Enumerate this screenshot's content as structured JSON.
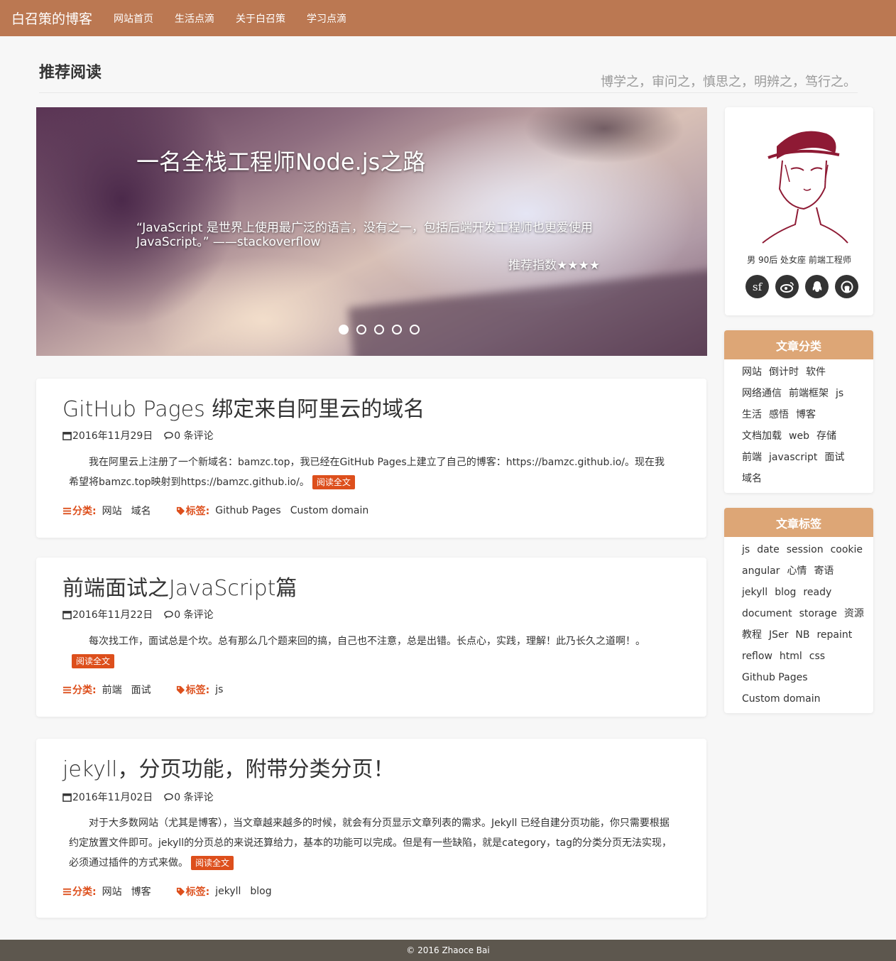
{
  "nav": {
    "brand": "白召策的博客",
    "items": [
      "网站首页",
      "生活点滴",
      "关于白召策",
      "学习点滴"
    ]
  },
  "header": {
    "title": "推荐阅读",
    "motto": "博学之，审问之，慎思之，明辨之，笃行之。"
  },
  "carousel": {
    "heading": "一名全栈工程师Node.js之路",
    "quote": "“JavaScript 是世界上使用最广泛的语言，没有之一，包括后端开发工程师也更爱使用 JavaScript。” ——stackoverflow",
    "rating": "推荐指数★★★★",
    "slide_count": 5,
    "active_index": 0
  },
  "posts": [
    {
      "title": "GitHub Pages 绑定来自阿里云的域名",
      "date": "2016年11月29日",
      "comments": "0 条评论",
      "excerpt": "我在阿里云上注册了一个新域名：bamzc.top，我已经在GitHub Pages上建立了自己的博客：https://bamzc.github.io/。现在我希望将bamzc.top映射到https://bamzc.github.io/。",
      "read_more": "阅读全文",
      "category_label": "分类:",
      "categories": [
        "网站",
        "域名"
      ],
      "tag_label": "标签:",
      "tags": [
        "Github Pages",
        "Custom domain"
      ]
    },
    {
      "title": "前端面试之JavaScript篇",
      "date": "2016年11月22日",
      "comments": "0 条评论",
      "excerpt": "每次找工作，面试总是个坎。总有那么几个题来回的搞，自己也不注意，总是出错。长点心，实践，理解！此乃长久之道啊！。",
      "read_more": "阅读全文",
      "category_label": "分类:",
      "categories": [
        "前端",
        "面试"
      ],
      "tag_label": "标签:",
      "tags": [
        "js"
      ]
    },
    {
      "title": "jekyll，分页功能，附带分类分页！",
      "date": "2016年11月02日",
      "comments": "0 条评论",
      "excerpt": "对于大多数网站（尤其是博客），当文章越来越多的时候，就会有分页显示文章列表的需求。Jekyll 已经自建分页功能，你只需要根据约定放置文件即可。jekyll的分页总的来说还算给力，基本的功能可以完成。但是有一些缺陷，就是category，tag的分类分页无法实现，必须通过插件的方式来做。",
      "read_more": "阅读全文",
      "category_label": "分类:",
      "categories": [
        "网站",
        "博客"
      ],
      "tag_label": "标签:",
      "tags": [
        "jekyll",
        "blog"
      ]
    }
  ],
  "profile": {
    "bio": "男 90后 处女座 前端工程师",
    "socials": [
      {
        "name": "segmentfault-icon",
        "glyph": "sf"
      },
      {
        "name": "weibo-icon",
        "glyph": ""
      },
      {
        "name": "qq-icon",
        "glyph": ""
      },
      {
        "name": "github-icon",
        "glyph": ""
      }
    ]
  },
  "categories_panel": {
    "title": "文章分类",
    "rows": [
      [
        "网站",
        "倒计时",
        "软件"
      ],
      [
        "网络通信",
        "前端框架",
        "js"
      ],
      [
        "生活",
        "感悟",
        "博客"
      ],
      [
        "文档加载",
        "web",
        "存储"
      ],
      [
        "前端",
        "javascript",
        "面试"
      ],
      [
        "域名"
      ]
    ]
  },
  "tags_panel": {
    "title": "文章标签",
    "rows": [
      [
        "js",
        "date",
        "session",
        "cookie"
      ],
      [
        "angular",
        "心情",
        "寄语"
      ],
      [
        "jekyll",
        "blog",
        "ready"
      ],
      [
        "document",
        "storage",
        "资源"
      ],
      [
        "教程",
        "JSer",
        "NB",
        "repaint"
      ],
      [
        "reflow",
        "html",
        "css"
      ],
      [
        "Github Pages"
      ],
      [
        "Custom domain"
      ]
    ]
  },
  "footer": {
    "copyright": "© 2016 Zhaoce Bai"
  },
  "colors": {
    "navbar": "#bb7852",
    "panel_header": "#dda676",
    "accent": "#dd4f1c",
    "footer": "#5d574e"
  }
}
